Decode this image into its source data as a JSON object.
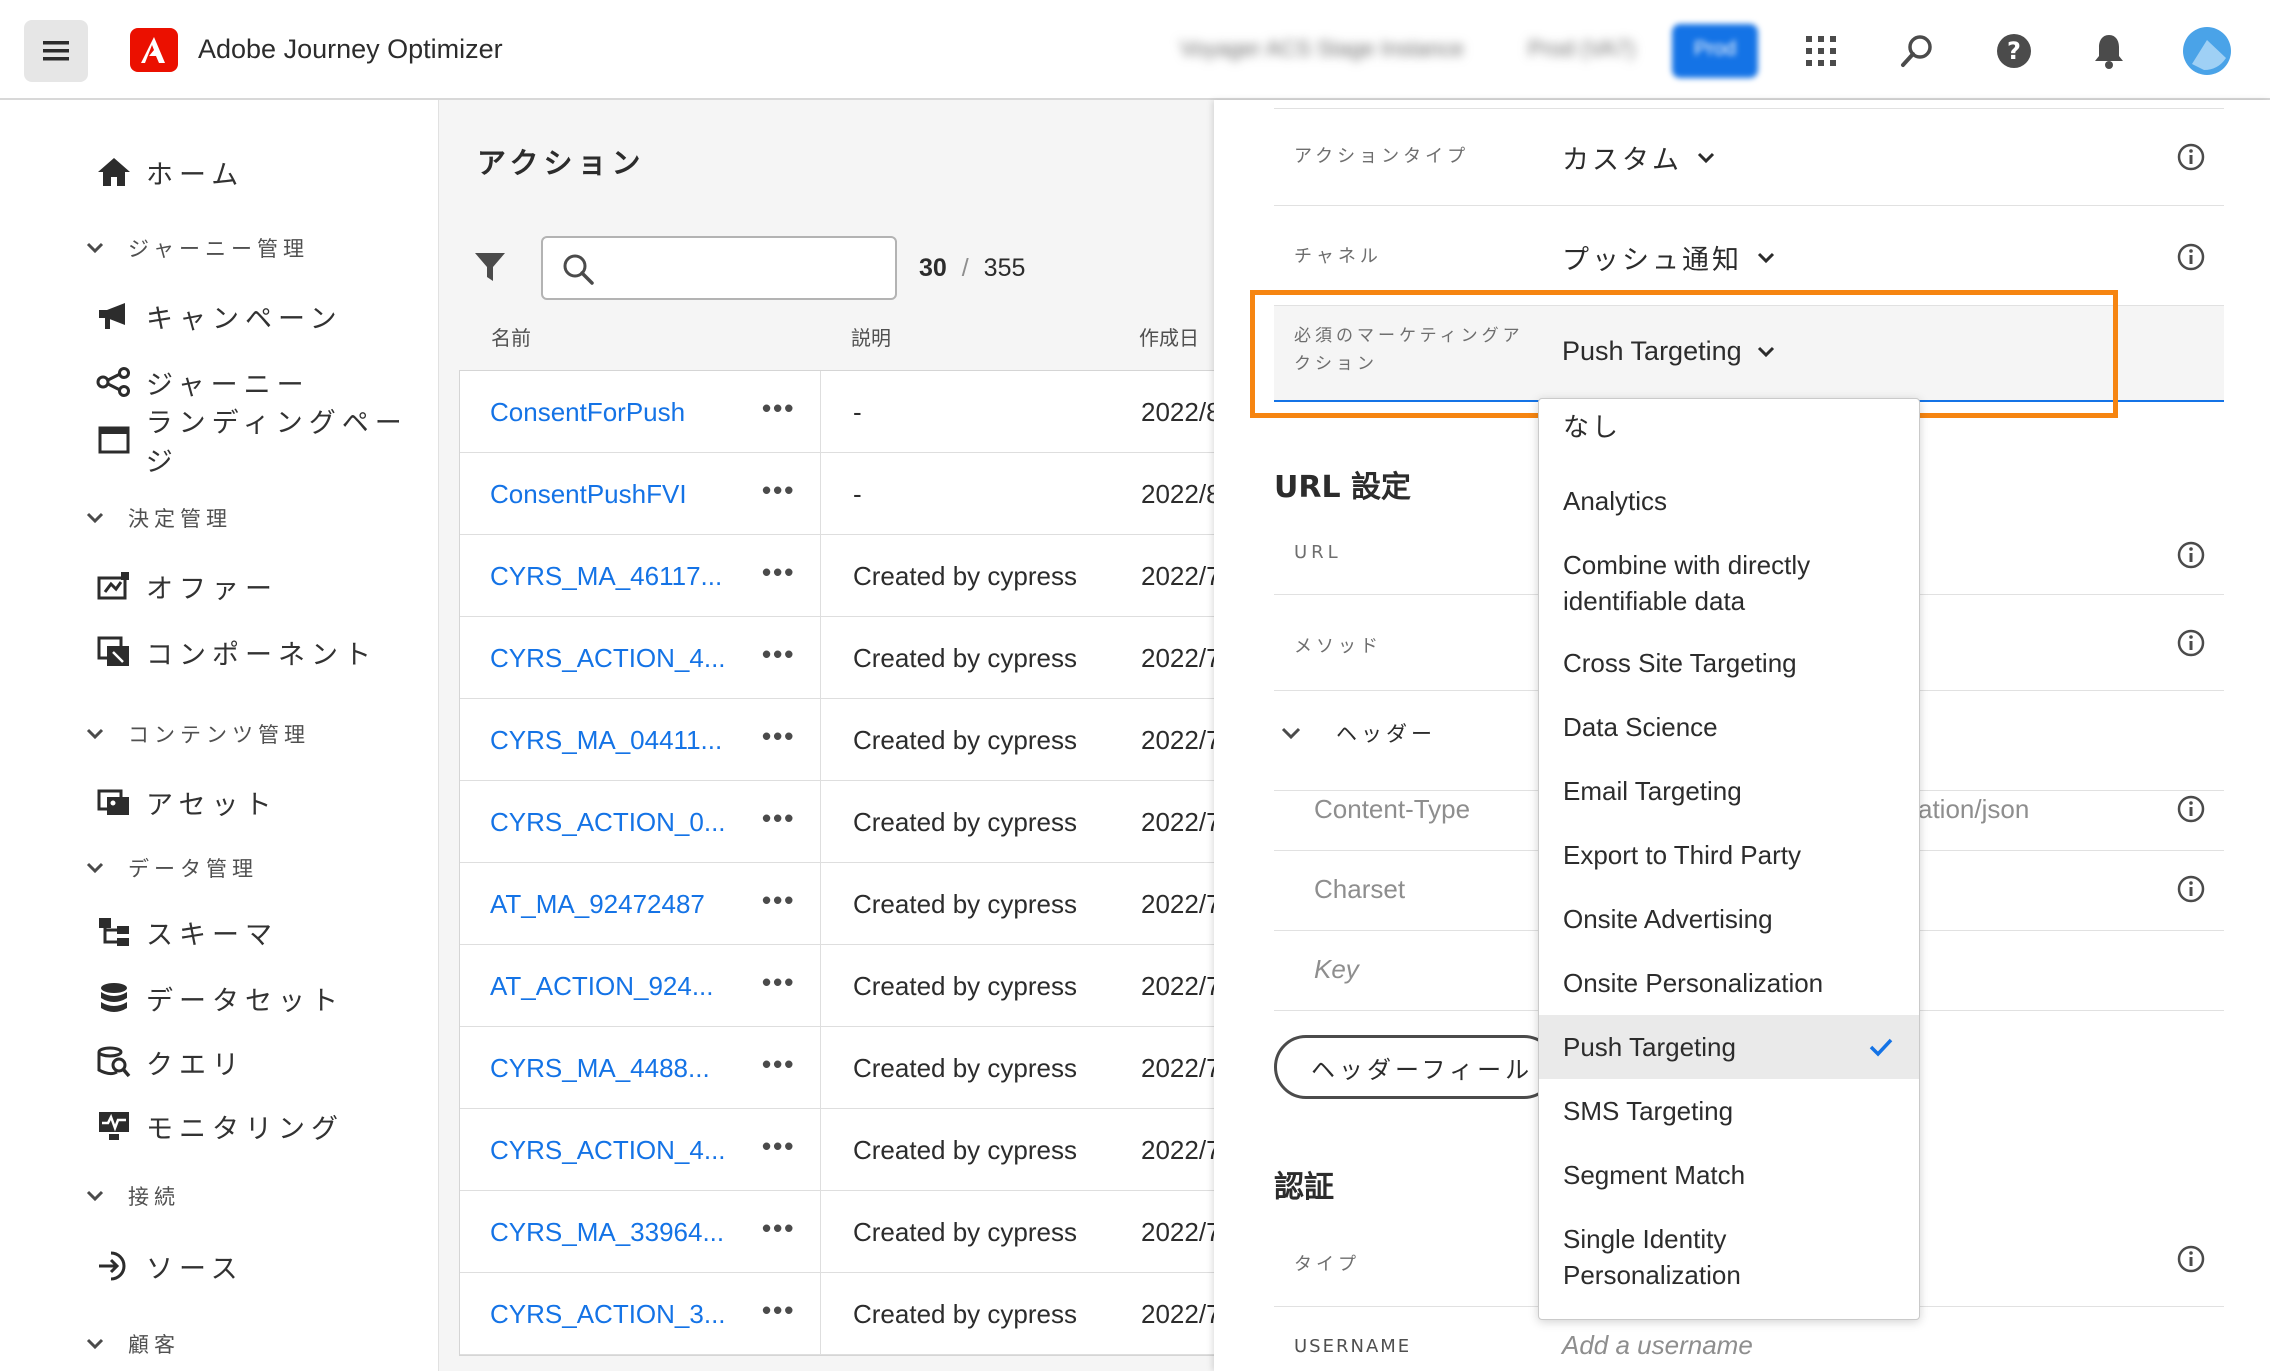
{
  "header": {
    "app_title": "Adobe Journey Optimizer",
    "org_blurred": "Voyager ACS Stage Instance",
    "sandbox_blurred": "Prod (VA7)",
    "env_badge_blurred": "Prod",
    "icons": [
      "menu-icon",
      "apps-icon",
      "search-icon",
      "help-icon",
      "bell-icon",
      "avatar"
    ]
  },
  "nav": {
    "home": "ホーム",
    "groups": [
      {
        "label": "ジャーニー管理",
        "items": [
          "キャンペーン",
          "ジャーニー",
          "ランディングページ"
        ]
      },
      {
        "label": "決定管理",
        "items": [
          "オファー",
          "コンポーネント"
        ]
      },
      {
        "label": "コンテンツ管理",
        "items": [
          "アセット"
        ]
      },
      {
        "label": "データ管理",
        "items": [
          "スキーマ",
          "データセット",
          "クエリ",
          "モニタリング"
        ]
      },
      {
        "label": "接続",
        "items": [
          "ソース"
        ]
      },
      {
        "label": "顧客",
        "items": []
      }
    ]
  },
  "list": {
    "title": "アクション",
    "search_placeholder": "",
    "count_shown": "30",
    "count_sep": "/",
    "count_total": "355",
    "columns": {
      "name": "名前",
      "description": "説明",
      "created": "作成日"
    },
    "rows": [
      {
        "name": "ConsentForPush",
        "more": "•••",
        "desc": "-",
        "date": "2022/8"
      },
      {
        "name": "ConsentPushFVI",
        "more": "•••",
        "desc": "-",
        "date": "2022/8"
      },
      {
        "name": "CYRS_MA_46117...",
        "more": "•••",
        "desc": "Created by cypress M",
        "date": "2022/7"
      },
      {
        "name": "CYRS_ACTION_4...",
        "more": "•••",
        "desc": "Created by cypress E",
        "date": "2022/7"
      },
      {
        "name": "CYRS_MA_04411...",
        "more": "•••",
        "desc": "Created by cypress M",
        "date": "2022/7"
      },
      {
        "name": "CYRS_ACTION_0...",
        "more": "•••",
        "desc": "Created by cypress E",
        "date": "2022/7"
      },
      {
        "name": "AT_MA_92472487",
        "more": "•••",
        "desc": "Created by cypress M",
        "date": "2022/7"
      },
      {
        "name": "AT_ACTION_924...",
        "more": "•••",
        "desc": "Created by cypress E",
        "date": "2022/7"
      },
      {
        "name": "CYRS_MA_4488...",
        "more": "•••",
        "desc": "Created by cypress M",
        "date": "2022/7"
      },
      {
        "name": "CYRS_ACTION_4...",
        "more": "•••",
        "desc": "Created by cypress E",
        "date": "2022/7"
      },
      {
        "name": "CYRS_MA_33964...",
        "more": "•••",
        "desc": "Created by cypress M",
        "date": "2022/7"
      },
      {
        "name": "CYRS_ACTION_3...",
        "more": "•••",
        "desc": "Created by cypress E",
        "date": "2022/7"
      }
    ]
  },
  "panel": {
    "action_type_label": "アクションタイプ",
    "action_type_value": "カスタム",
    "channel_label": "チャネル",
    "channel_value": "プッシュ通知",
    "marketing_label_1": "必須のマーケティングア",
    "marketing_label_2": "クション",
    "marketing_value": "Push Targeting",
    "url_section": "URL 設定",
    "url_label": "URL",
    "method_label": "メソッド",
    "headers_label": "ヘッダー",
    "content_type_placeholder": "Content-Type",
    "content_type_value_partial": "ation/json",
    "charset_placeholder": "Charset",
    "key_placeholder": "Key",
    "header_field_button": "ヘッダーフィール",
    "auth_section": "認証",
    "type_label": "タイプ",
    "username_label": "USERNAME",
    "username_placeholder": "Add a username"
  },
  "dropdown": {
    "options": [
      {
        "label": "なし"
      },
      {
        "label": "Analytics"
      },
      {
        "label": "Combine with directly identifiable data"
      },
      {
        "label": "Cross Site Targeting"
      },
      {
        "label": "Data Science"
      },
      {
        "label": "Email Targeting"
      },
      {
        "label": "Export to Third Party"
      },
      {
        "label": "Onsite Advertising"
      },
      {
        "label": "Onsite Personalization"
      },
      {
        "label": "Push Targeting",
        "selected": true
      },
      {
        "label": "SMS Targeting"
      },
      {
        "label": "Segment Match"
      },
      {
        "label": "Single Identity Personalization"
      }
    ]
  },
  "colors": {
    "accent": "#1473e6",
    "highlight": "#f68511",
    "brand": "#eb1000"
  }
}
